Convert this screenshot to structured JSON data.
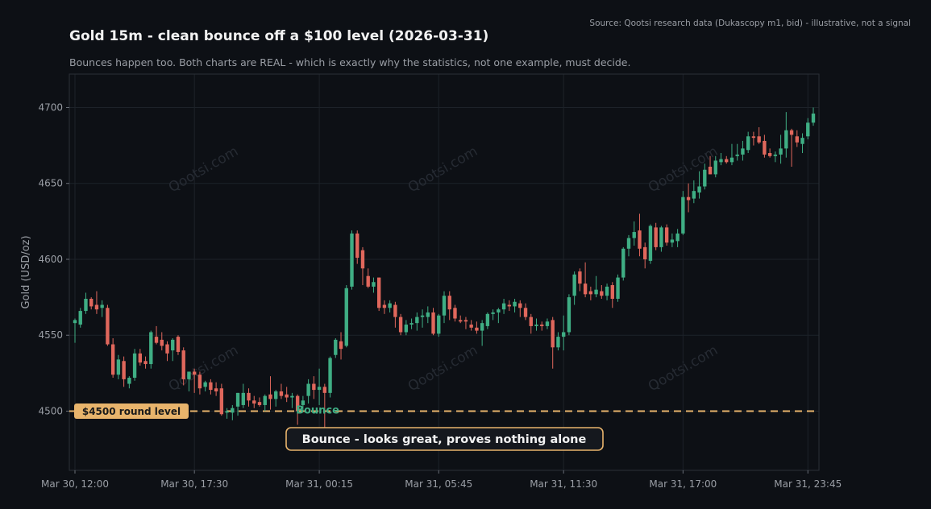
{
  "header": {
    "title": "Gold 15m - clean bounce off a $100 level (2026-03-31)",
    "subtitle": "Bounces happen too. Both charts are REAL - which is exactly why the statistics, not one example, must decide.",
    "source": "Source: Qootsi research data (Dukascopy m1, bid) - illustrative, not a signal"
  },
  "watermark": "Qootsi.com",
  "chart_data": {
    "type": "candlestick",
    "title": "Gold 15m - clean bounce off a $100 level (2026-03-31)",
    "ylabel": "Gold (USD/oz)",
    "xlabel": "",
    "ylim": [
      4461,
      4722
    ],
    "y_ticks": [
      4500,
      4550,
      4600,
      4650,
      4700
    ],
    "x_tick_labels": [
      "Mar 30, 12:00",
      "Mar 30, 17:30",
      "Mar 31, 00:15",
      "Mar 31, 05:45",
      "Mar 31, 11:30",
      "Mar 31, 17:00",
      "Mar 31, 23:45"
    ],
    "x_tick_index": [
      0,
      22,
      45,
      67,
      90,
      112,
      135
    ],
    "grid": true,
    "level": {
      "value": 4500,
      "label": "$4500 round level"
    },
    "annotation": {
      "text": "Bounce - looks great, proves nothing alone",
      "pointer_label": "Bounce",
      "index": 45
    },
    "colors": {
      "up": "#3fae84",
      "down": "#e0675c",
      "level": "#e8b46c",
      "background": "#0d1015",
      "grid": "#1d2229"
    },
    "ohlc": [
      [
        4558,
        4561,
        4545,
        4560
      ],
      [
        4557,
        4568,
        4555,
        4566
      ],
      [
        4566,
        4578,
        4564,
        4574
      ],
      [
        4574,
        4575,
        4567,
        4569
      ],
      [
        4570,
        4579,
        4564,
        4567
      ],
      [
        4568,
        4573,
        4562,
        4570
      ],
      [
        4568,
        4570,
        4543,
        4544
      ],
      [
        4544,
        4548,
        4522,
        4524
      ],
      [
        4524,
        4537,
        4521,
        4534
      ],
      [
        4533,
        4536,
        4516,
        4521
      ],
      [
        4518,
        4523,
        4515,
        4522
      ],
      [
        4522,
        4541,
        4520,
        4538
      ],
      [
        4538,
        4541,
        4530,
        4532
      ],
      [
        4533,
        4536,
        4528,
        4531
      ],
      [
        4531,
        4553,
        4528,
        4552
      ],
      [
        4549,
        4556,
        4544,
        4545
      ],
      [
        4547,
        4552,
        4540,
        4543
      ],
      [
        4544,
        4546,
        4533,
        4538
      ],
      [
        4540,
        4548,
        4533,
        4547
      ],
      [
        4549,
        4550,
        4537,
        4539
      ],
      [
        4540,
        4542,
        4517,
        4521
      ],
      [
        4521,
        4526,
        4513,
        4526
      ],
      [
        4526,
        4528,
        4512,
        4524
      ],
      [
        4524,
        4526,
        4511,
        4515
      ],
      [
        4516,
        4520,
        4513,
        4519
      ],
      [
        4519,
        4521,
        4511,
        4514
      ],
      [
        4515,
        4519,
        4510,
        4513
      ],
      [
        4515,
        4518,
        4497,
        4498
      ],
      [
        4499,
        4502,
        4495,
        4500
      ],
      [
        4499,
        4504,
        4494,
        4502
      ],
      [
        4503,
        4512,
        4497,
        4512
      ],
      [
        4504,
        4518,
        4502,
        4512
      ],
      [
        4512,
        4515,
        4503,
        4507
      ],
      [
        4507,
        4510,
        4502,
        4505
      ],
      [
        4506,
        4509,
        4503,
        4504
      ],
      [
        4504,
        4511,
        4500,
        4510
      ],
      [
        4511,
        4523,
        4501,
        4508
      ],
      [
        4508,
        4514,
        4503,
        4513
      ],
      [
        4513,
        4518,
        4508,
        4510
      ],
      [
        4511,
        4516,
        4506,
        4509
      ],
      [
        4509,
        4512,
        4502,
        4510
      ],
      [
        4510,
        4511,
        4491,
        4500
      ],
      [
        4504,
        4510,
        4500,
        4507
      ],
      [
        4510,
        4521,
        4505,
        4518
      ],
      [
        4518,
        4523,
        4508,
        4514
      ],
      [
        4514,
        4528,
        4504,
        4516
      ],
      [
        4516,
        4518,
        4486,
        4512
      ],
      [
        4512,
        4536,
        4509,
        4535
      ],
      [
        4537,
        4548,
        4535,
        4547
      ],
      [
        4546,
        4552,
        4534,
        4541
      ],
      [
        4543,
        4583,
        4542,
        4581
      ],
      [
        4582,
        4619,
        4580,
        4617
      ],
      [
        4617,
        4619,
        4597,
        4601
      ],
      [
        4606,
        4608,
        4583,
        4594
      ],
      [
        4589,
        4594,
        4581,
        4582
      ],
      [
        4582,
        4588,
        4578,
        4585
      ],
      [
        4588,
        4588,
        4566,
        4568
      ],
      [
        4570,
        4573,
        4564,
        4568
      ],
      [
        4568,
        4573,
        4565,
        4571
      ],
      [
        4570,
        4572,
        4555,
        4562
      ],
      [
        4562,
        4564,
        4550,
        4552
      ],
      [
        4552,
        4560,
        4550,
        4557
      ],
      [
        4557,
        4561,
        4554,
        4558
      ],
      [
        4558,
        4565,
        4553,
        4562
      ],
      [
        4562,
        4567,
        4555,
        4563
      ],
      [
        4562,
        4569,
        4558,
        4565
      ],
      [
        4565,
        4568,
        4550,
        4551
      ],
      [
        4551,
        4564,
        4549,
        4563
      ],
      [
        4563,
        4579,
        4558,
        4576
      ],
      [
        4576,
        4579,
        4560,
        4567
      ],
      [
        4568,
        4570,
        4559,
        4561
      ],
      [
        4560,
        4563,
        4558,
        4559
      ],
      [
        4560,
        4562,
        4554,
        4559
      ],
      [
        4557,
        4560,
        4553,
        4555
      ],
      [
        4555,
        4559,
        4551,
        4553
      ],
      [
        4553,
        4560,
        4543,
        4558
      ],
      [
        4556,
        4565,
        4554,
        4564
      ],
      [
        4564,
        4567,
        4560,
        4565
      ],
      [
        4565,
        4568,
        4558,
        4567
      ],
      [
        4567,
        4574,
        4564,
        4571
      ],
      [
        4570,
        4573,
        4566,
        4569
      ],
      [
        4569,
        4574,
        4565,
        4572
      ],
      [
        4571,
        4573,
        4562,
        4568
      ],
      [
        4568,
        4571,
        4560,
        4562
      ],
      [
        4562,
        4564,
        4551,
        4556
      ],
      [
        4556,
        4561,
        4553,
        4557
      ],
      [
        4557,
        4559,
        4553,
        4556
      ],
      [
        4556,
        4561,
        4554,
        4559
      ],
      [
        4560,
        4562,
        4528,
        4542
      ],
      [
        4542,
        4552,
        4540,
        4549
      ],
      [
        4549,
        4563,
        4540,
        4552
      ],
      [
        4552,
        4577,
        4550,
        4575
      ],
      [
        4576,
        4592,
        4570,
        4590
      ],
      [
        4592,
        4594,
        4579,
        4584
      ],
      [
        4584,
        4598,
        4575,
        4577
      ],
      [
        4579,
        4582,
        4573,
        4577
      ],
      [
        4577,
        4589,
        4575,
        4580
      ],
      [
        4579,
        4583,
        4574,
        4576
      ],
      [
        4576,
        4584,
        4573,
        4582
      ],
      [
        4583,
        4585,
        4568,
        4574
      ],
      [
        4574,
        4590,
        4572,
        4588
      ],
      [
        4588,
        4608,
        4586,
        4607
      ],
      [
        4607,
        4616,
        4602,
        4614
      ],
      [
        4614,
        4625,
        4609,
        4618
      ],
      [
        4619,
        4630,
        4602,
        4607
      ],
      [
        4608,
        4611,
        4594,
        4600
      ],
      [
        4599,
        4623,
        4597,
        4622
      ],
      [
        4621,
        4624,
        4606,
        4608
      ],
      [
        4608,
        4622,
        4605,
        4621
      ],
      [
        4621,
        4623,
        4609,
        4611
      ],
      [
        4611,
        4617,
        4608,
        4613
      ],
      [
        4612,
        4620,
        4608,
        4617
      ],
      [
        4617,
        4645,
        4616,
        4641
      ],
      [
        4641,
        4650,
        4631,
        4639
      ],
      [
        4640,
        4652,
        4637,
        4645
      ],
      [
        4644,
        4658,
        4640,
        4648
      ],
      [
        4648,
        4663,
        4646,
        4659
      ],
      [
        4661,
        4668,
        4656,
        4656
      ],
      [
        4656,
        4668,
        4654,
        4665
      ],
      [
        4664,
        4670,
        4662,
        4666
      ],
      [
        4666,
        4668,
        4663,
        4664
      ],
      [
        4664,
        4676,
        4662,
        4667
      ],
      [
        4668,
        4676,
        4665,
        4669
      ],
      [
        4669,
        4678,
        4665,
        4673
      ],
      [
        4672,
        4684,
        4670,
        4681
      ],
      [
        4681,
        4684,
        4675,
        4680
      ],
      [
        4681,
        4687,
        4676,
        4677
      ],
      [
        4678,
        4682,
        4667,
        4669
      ],
      [
        4670,
        4673,
        4667,
        4668
      ],
      [
        4668,
        4671,
        4664,
        4669
      ],
      [
        4669,
        4682,
        4663,
        4673
      ],
      [
        4673,
        4697,
        4667,
        4685
      ],
      [
        4685,
        4686,
        4661,
        4682
      ],
      [
        4681,
        4685,
        4674,
        4677
      ],
      [
        4676,
        4683,
        4670,
        4680
      ],
      [
        4681,
        4693,
        4679,
        4690
      ],
      [
        4690,
        4700,
        4688,
        4696
      ]
    ]
  }
}
